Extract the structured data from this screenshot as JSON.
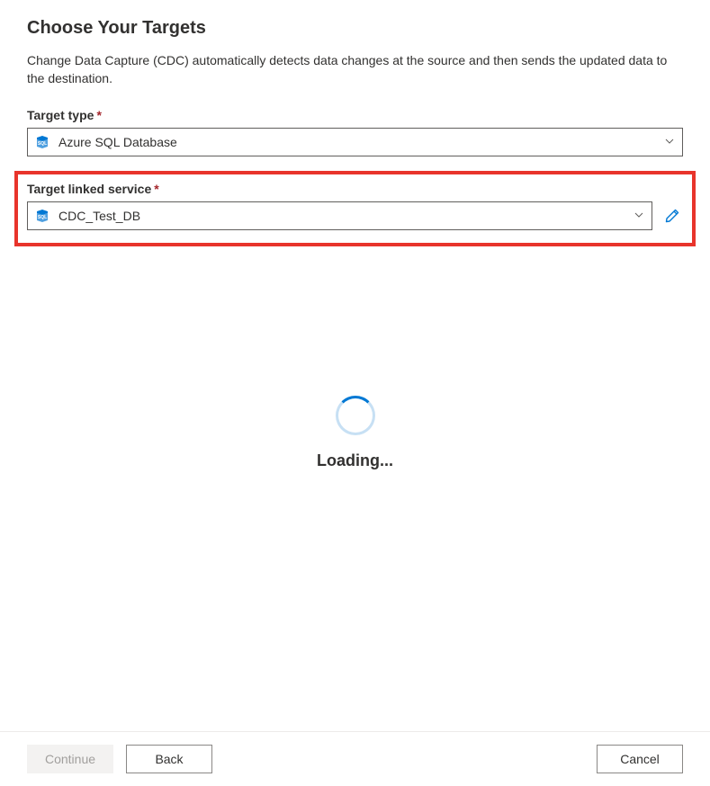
{
  "title": "Choose Your Targets",
  "description": "Change Data Capture (CDC) automatically detects data changes at the source and then sends the updated data to the destination.",
  "targetType": {
    "label": "Target type",
    "value": "Azure SQL Database",
    "icon": "azure-sql-icon"
  },
  "linkedService": {
    "label": "Target linked service",
    "value": "CDC_Test_DB",
    "icon": "azure-sql-icon"
  },
  "loading": {
    "text": "Loading..."
  },
  "footer": {
    "continue": "Continue",
    "back": "Back",
    "cancel": "Cancel"
  }
}
